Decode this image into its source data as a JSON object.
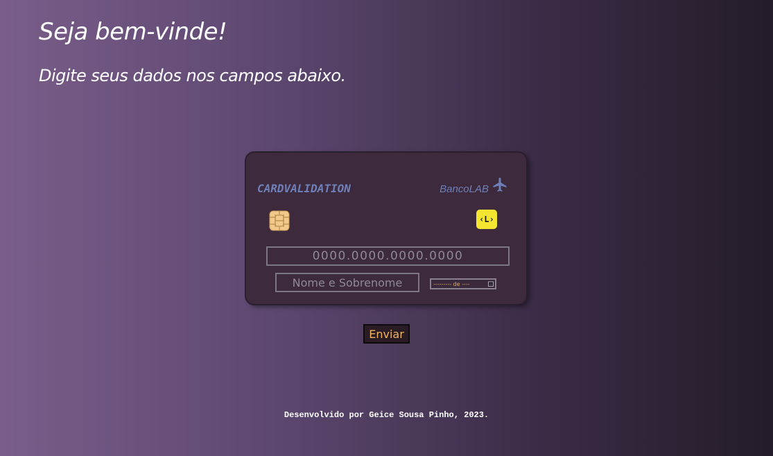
{
  "header": {
    "title": "Seja bem-vinde!",
    "subtitle": "Digite seus dados nos campos abaixo."
  },
  "card": {
    "brand": "CARDVALIDATION",
    "bank": "BancoLAB",
    "bank_icon": "airplane-icon",
    "chip_icon": "chip-icon",
    "logo_badge": "‹L›",
    "number_placeholder": "0000.0000.0000.0000",
    "name_placeholder": "Nome e Sobrenome",
    "expiry_placeholder": "--------- de ----",
    "accent_color": "#6f7fb8",
    "badge_color": "#f4e531"
  },
  "form": {
    "submit_label": "Enviar"
  },
  "footer": {
    "credit": "Desenvolvido por Geice Sousa Pinho, 2023."
  }
}
